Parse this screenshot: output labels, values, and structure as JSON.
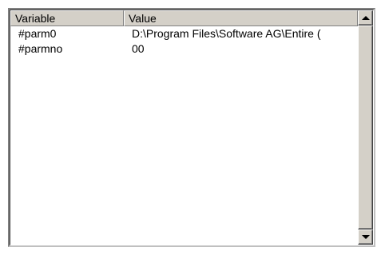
{
  "table": {
    "columns": [
      "Variable",
      "Value"
    ],
    "rows": [
      {
        "variable": "#parm0",
        "value": "D:\\Program Files\\Software AG\\Entire ("
      },
      {
        "variable": "#parmno",
        "value": "00"
      }
    ]
  },
  "scrollbar": {
    "up_icon": "arrow-up-icon",
    "down_icon": "arrow-down-icon"
  },
  "colors": {
    "face": "#d4d0c8",
    "background": "#ffffff"
  }
}
